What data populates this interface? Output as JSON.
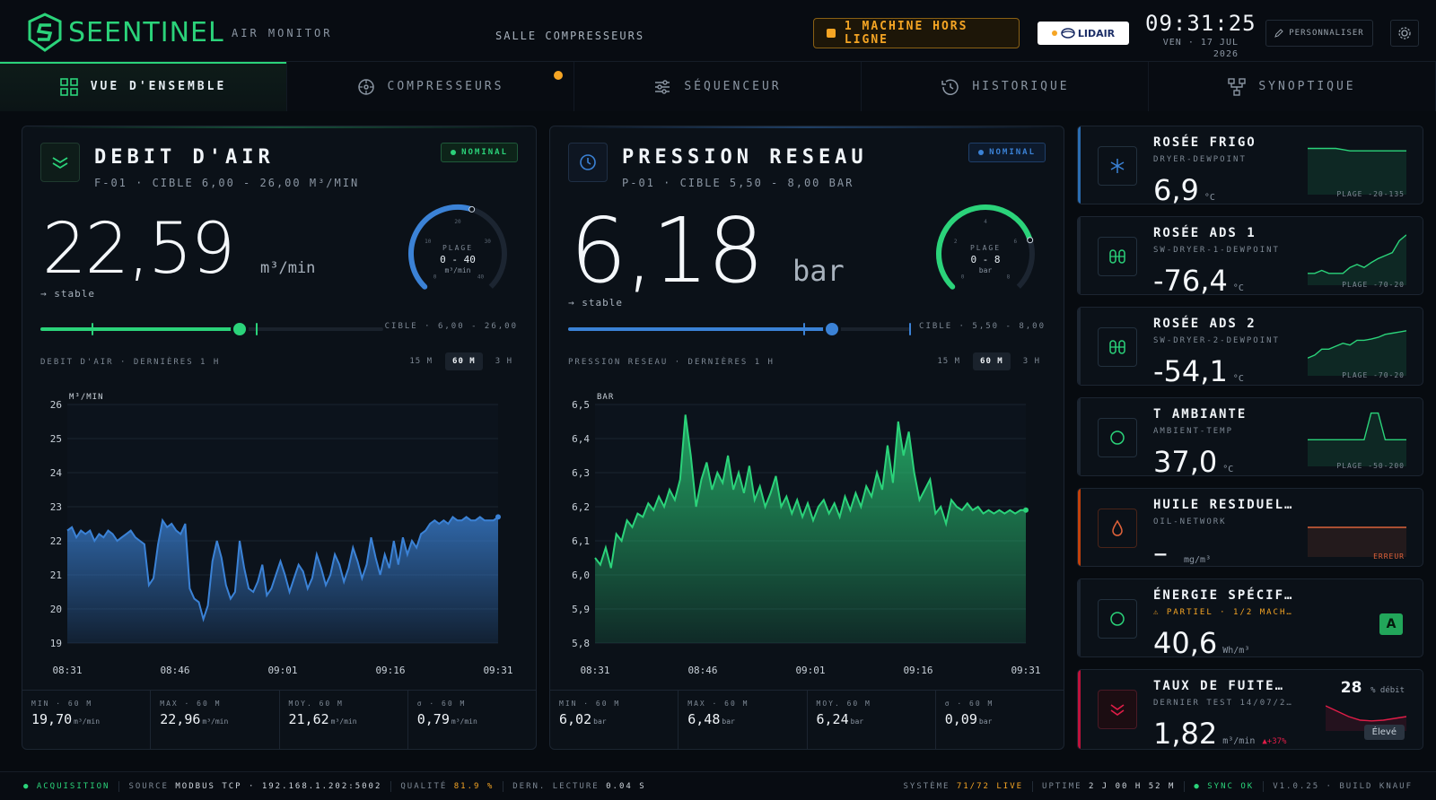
{
  "header": {
    "brand": "SEENTINEL",
    "subtitle": "AIR MONITOR",
    "location": "SALLE COMPRESSEURS",
    "alert": "1 MACHINE HORS LIGNE",
    "partner": "LIDAIR",
    "time": "09:31:25",
    "date_line1": "VEN · 17 JUL",
    "date_line2": "2026",
    "customize": "PERSONNALISER"
  },
  "tabs": [
    {
      "label": "VUE D'ENSEMBLE",
      "icon": "grid-icon"
    },
    {
      "label": "COMPRESSEURS",
      "icon": "fan-icon"
    },
    {
      "label": "SÉQUENCEUR",
      "icon": "sliders-icon"
    },
    {
      "label": "HISTORIQUE",
      "icon": "history-icon"
    },
    {
      "label": "SYNOPTIQUE",
      "icon": "diagram-icon"
    }
  ],
  "air": {
    "title": "DEBIT D'AIR",
    "subtitle": "F-01 · CIBLE 6,00 - 26,00 M³/MIN",
    "status": "NOMINAL",
    "value": "22,59",
    "unit": "m³/min",
    "trend": "→ stable",
    "gauge_label": "PLAGE",
    "gauge_range": "0 - 40",
    "gauge_unit": "m³/min",
    "gauge_ticks": [
      "0",
      "10",
      "20",
      "30",
      "40"
    ],
    "gauge_fraction": 0.565,
    "slider_fraction": 0.58,
    "cible": "CIBLE · 6,00 - 26,00",
    "history_label": "DEBIT D'AIR · DERNIÈRES 1 H",
    "ranges": [
      "15 M",
      "60 M",
      "3 H"
    ],
    "stats": [
      {
        "label": "MIN · 60 M",
        "value": "19,70",
        "unit": "m³/min"
      },
      {
        "label": "MAX · 60 M",
        "value": "22,96",
        "unit": "m³/min"
      },
      {
        "label": "MOY. 60 M",
        "value": "21,62",
        "unit": "m³/min"
      },
      {
        "label": "σ · 60 M",
        "value": "0,79",
        "unit": "m³/min"
      }
    ]
  },
  "pressure": {
    "title": "PRESSION RESEAU",
    "subtitle": "P-01 · CIBLE 5,50 - 8,00 BAR",
    "status": "NOMINAL",
    "value": "6,18",
    "unit": "bar",
    "trend": "→ stable",
    "gauge_label": "PLAGE",
    "gauge_range": "0 - 8",
    "gauge_unit": "bar",
    "gauge_ticks": [
      "0",
      "2",
      "4",
      "6",
      "8"
    ],
    "gauge_fraction": 0.77,
    "slider_fraction": 0.77,
    "cible": "CIBLE · 5,50 - 8,00",
    "history_label": "PRESSION RESEAU · DERNIÈRES 1 H",
    "ranges": [
      "15 M",
      "60 M",
      "3 H"
    ],
    "stats": [
      {
        "label": "MIN · 60 M",
        "value": "6,02",
        "unit": "bar"
      },
      {
        "label": "MAX · 60 M",
        "value": "6,48",
        "unit": "bar"
      },
      {
        "label": "MOY. 60 M",
        "value": "6,24",
        "unit": "bar"
      },
      {
        "label": "σ · 60 M",
        "value": "0,09",
        "unit": "bar"
      }
    ]
  },
  "chart_data": [
    {
      "type": "area",
      "ylabel": "M³/MIN",
      "ylim": [
        19,
        26
      ],
      "yticks": [
        "26",
        "25",
        "24",
        "23",
        "22",
        "21",
        "20",
        "19"
      ],
      "xticks": [
        "08:31",
        "08:46",
        "09:01",
        "09:16",
        "09:31"
      ],
      "color": "#3b82d6",
      "values": [
        22.3,
        22.4,
        22.1,
        22.3,
        22.2,
        22.3,
        22.0,
        22.2,
        22.1,
        22.3,
        22.2,
        22.0,
        22.1,
        22.2,
        22.3,
        22.1,
        22.0,
        21.9,
        20.7,
        20.9,
        21.9,
        22.6,
        22.4,
        22.5,
        22.3,
        22.2,
        22.5,
        20.6,
        20.3,
        20.2,
        19.7,
        20.1,
        21.4,
        22.0,
        21.5,
        20.7,
        20.3,
        20.5,
        22.0,
        21.2,
        20.6,
        20.5,
        20.8,
        21.3,
        20.4,
        20.6,
        21.0,
        21.4,
        21.0,
        20.5,
        20.9,
        21.3,
        21.1,
        20.6,
        20.9,
        21.6,
        21.2,
        20.7,
        21.0,
        21.6,
        21.3,
        20.8,
        21.2,
        21.8,
        21.4,
        20.9,
        21.3,
        22.1,
        21.5,
        21.0,
        21.6,
        21.2,
        22.0,
        21.3,
        22.1,
        21.6,
        22.0,
        21.8,
        22.2,
        22.3,
        22.5,
        22.6,
        22.5,
        22.6,
        22.5,
        22.7,
        22.6,
        22.6,
        22.7,
        22.6,
        22.6,
        22.7,
        22.6,
        22.6,
        22.6,
        22.7
      ]
    },
    {
      "type": "area",
      "ylabel": "BAR",
      "ylim": [
        5.8,
        6.5
      ],
      "yticks": [
        "6,5",
        "6,4",
        "6,3",
        "6,2",
        "6,1",
        "6,0",
        "5,9",
        "5,8"
      ],
      "xticks": [
        "08:31",
        "08:46",
        "09:01",
        "09:16",
        "09:31"
      ],
      "color": "#2bd37a",
      "values": [
        6.05,
        6.03,
        6.08,
        6.02,
        6.12,
        6.1,
        6.16,
        6.14,
        6.18,
        6.17,
        6.21,
        6.19,
        6.23,
        6.2,
        6.25,
        6.22,
        6.28,
        6.47,
        6.35,
        6.2,
        6.28,
        6.33,
        6.25,
        6.3,
        6.27,
        6.35,
        6.25,
        6.3,
        6.24,
        6.32,
        6.22,
        6.26,
        6.2,
        6.24,
        6.29,
        6.2,
        6.23,
        6.18,
        6.22,
        6.17,
        6.21,
        6.16,
        6.2,
        6.22,
        6.18,
        6.21,
        6.17,
        6.23,
        6.19,
        6.24,
        6.2,
        6.26,
        6.23,
        6.3,
        6.25,
        6.38,
        6.27,
        6.45,
        6.35,
        6.42,
        6.3,
        6.22,
        6.25,
        6.28,
        6.18,
        6.2,
        6.15,
        6.22,
        6.2,
        6.19,
        6.21,
        6.19,
        6.2,
        6.18,
        6.19,
        6.18,
        6.19,
        6.18,
        6.19,
        6.18,
        6.19,
        6.19
      ]
    }
  ],
  "sensors": [
    {
      "title": "ROSÉE FRIGO",
      "sub": "DRYER-DEWPOINT",
      "value": "6,9",
      "unit": "°C",
      "range": "PLAGE -20-135",
      "accent": "#2b6cb0",
      "icon": "snowflake-icon",
      "spark": [
        0.78,
        0.78,
        0.78,
        0.78,
        0.78,
        0.76,
        0.74,
        0.74,
        0.74,
        0.74,
        0.74,
        0.74,
        0.74,
        0.74,
        0.74
      ],
      "spark_color": "#2bd37a"
    },
    {
      "title": "ROSÉE ADS 1",
      "sub": "SW-DRYER-1-DEWPOINT",
      "value": "-76,4",
      "unit": "°C",
      "range": "PLAGE -70-20",
      "accent": "#1c2531",
      "icon": "dryer-icon",
      "spark": [
        0.2,
        0.2,
        0.25,
        0.2,
        0.2,
        0.2,
        0.3,
        0.35,
        0.3,
        0.38,
        0.45,
        0.5,
        0.55,
        0.75,
        0.85
      ],
      "spark_color": "#2bd37a"
    },
    {
      "title": "ROSÉE ADS 2",
      "sub": "SW-DRYER-2-DEWPOINT",
      "value": "-54,1",
      "unit": "°C",
      "range": "PLAGE -70-20",
      "accent": "#1c2531",
      "icon": "dryer-icon",
      "spark": [
        0.3,
        0.35,
        0.45,
        0.45,
        0.5,
        0.55,
        0.52,
        0.6,
        0.6,
        0.62,
        0.65,
        0.7,
        0.72,
        0.74,
        0.76
      ],
      "spark_color": "#2bd37a"
    },
    {
      "title": "T AMBIANTE",
      "sub": "AMBIENT-TEMP",
      "value": "37,0",
      "unit": "°C",
      "range": "PLAGE -50-200",
      "accent": "#1c2531",
      "icon": "circle-icon",
      "spark": [
        0.45,
        0.45,
        0.45,
        0.45,
        0.45,
        0.45,
        0.45,
        0.45,
        0.45,
        0.9,
        0.9,
        0.45,
        0.45,
        0.45,
        0.45
      ],
      "spark_color": "#2bd37a"
    },
    {
      "title": "HUILE RESIDUEL…",
      "sub": "OIL-NETWORK",
      "value": "–",
      "unit": "mg/m³",
      "range": "ERREUR",
      "accent": "#c2410c",
      "icon": "drop-icon",
      "spark": [
        0.5,
        0.5,
        0.5,
        0.5,
        0.5,
        0.5,
        0.5,
        0.5,
        0.5,
        0.5,
        0.5,
        0.5,
        0.5,
        0.5,
        0.5
      ],
      "spark_color": "#d9623a"
    },
    {
      "title": "ÉNERGIE SPÉCIF…",
      "sub": "⚠ PARTIEL · 1/2 MACH…",
      "value": "40,6",
      "unit": "Wh/m³",
      "range": "",
      "accent": "#1c2531",
      "icon": "circle-icon",
      "grade": "A",
      "spark": [],
      "spark_color": "#2bd37a"
    },
    {
      "title": "TAUX DE FUITE…",
      "sub": "DERNIER TEST 14/07/2…",
      "value": "1,82",
      "unit": "m³/min",
      "range": "",
      "accent": "#be123c",
      "icon": "leak-icon",
      "leak_pct": "28",
      "leak_pct_label": "% débit",
      "delta": "▲+37%",
      "level": "Élevé",
      "spark": [
        0.7,
        0.55,
        0.4,
        0.3,
        0.28,
        0.3,
        0.35,
        0.4
      ],
      "spark_color": "#e11d48"
    }
  ],
  "footer": {
    "acq": "ACQUISITION",
    "source_label": "SOURCE",
    "source_value": "MODBUS TCP · 192.168.1.202:5002",
    "quality_label": "QUALITÉ",
    "quality_value": "81.9 %",
    "last_label": "DERN. LECTURE",
    "last_value": "0.04 S",
    "system_label": "SYSTÈME",
    "system_value": "71/72 LIVE",
    "uptime_label": "UPTIME",
    "uptime_value": "2 J 00 H 52 M",
    "sync": "SYNC OK",
    "build": "V1.0.25 · BUILD KNAUF"
  }
}
